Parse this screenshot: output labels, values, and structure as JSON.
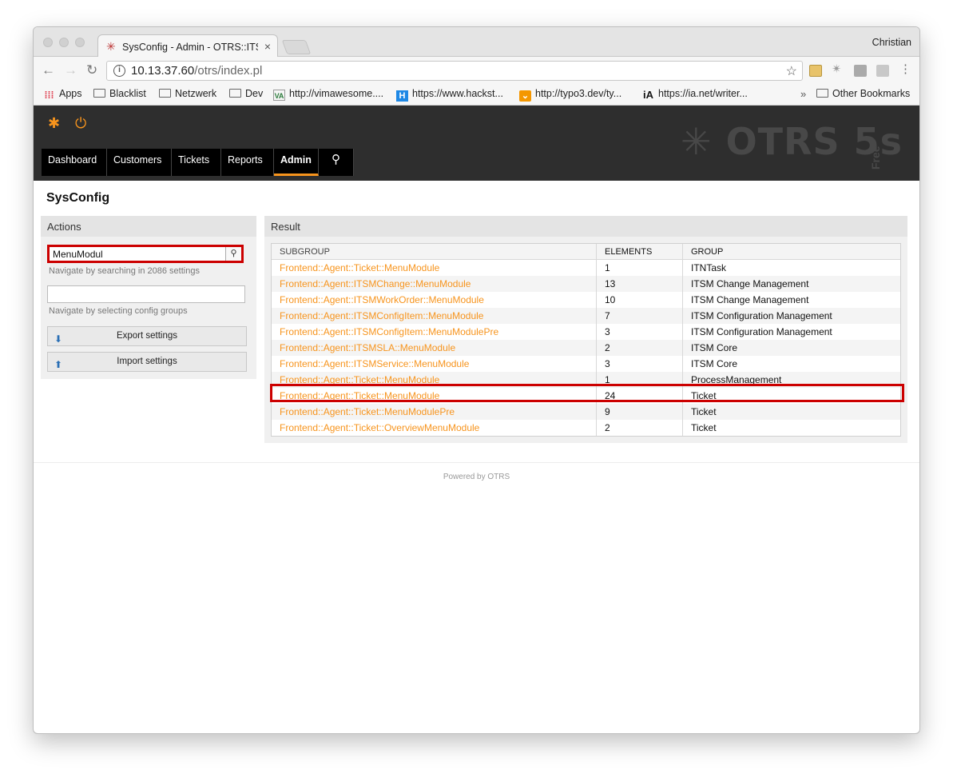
{
  "browser": {
    "tab_title": "SysConfig - Admin - OTRS::ITSM",
    "user_name": "Christian",
    "url_host": "10.13.37.60",
    "url_path": "/otrs/index.pl"
  },
  "bookmarks": {
    "apps": "Apps",
    "items": [
      "Blacklist",
      "Netzwerk",
      "Dev",
      "http://vimawesome....",
      "https://www.hackst...",
      "http://typo3.dev/ty...",
      "https://ia.net/writer..."
    ],
    "overflow": "»",
    "other": "Other Bookmarks"
  },
  "otrs": {
    "logo_text": "OTRS 5s",
    "logo_sub": "Free",
    "nav": [
      "Dashboard",
      "Customers",
      "Tickets",
      "Reports",
      "Admin"
    ],
    "active_nav": "Admin"
  },
  "page": {
    "title": "SysConfig"
  },
  "actions": {
    "header": "Actions",
    "search_value": "MenuModul",
    "search_hint": "Navigate by searching in 2086 settings",
    "group_hint": "Navigate by selecting config groups",
    "export_label": "Export settings",
    "import_label": "Import settings"
  },
  "result": {
    "header": "Result",
    "columns": [
      "SUBGROUP",
      "ELEMENTS",
      "GROUP"
    ],
    "rows": [
      {
        "subgroup": "Frontend::Agent::Ticket::MenuModule",
        "elements": "1",
        "group": "ITNTask"
      },
      {
        "subgroup": "Frontend::Agent::ITSMChange::MenuModule",
        "elements": "13",
        "group": "ITSM Change Management"
      },
      {
        "subgroup": "Frontend::Agent::ITSMWorkOrder::MenuModule",
        "elements": "10",
        "group": "ITSM Change Management"
      },
      {
        "subgroup": "Frontend::Agent::ITSMConfigItem::MenuModule",
        "elements": "7",
        "group": "ITSM Configuration Management"
      },
      {
        "subgroup": "Frontend::Agent::ITSMConfigItem::MenuModulePre",
        "elements": "3",
        "group": "ITSM Configuration Management"
      },
      {
        "subgroup": "Frontend::Agent::ITSMSLA::MenuModule",
        "elements": "2",
        "group": "ITSM Core"
      },
      {
        "subgroup": "Frontend::Agent::ITSMService::MenuModule",
        "elements": "3",
        "group": "ITSM Core"
      },
      {
        "subgroup": "Frontend::Agent::Ticket::MenuModule",
        "elements": "1",
        "group": "ProcessManagement"
      },
      {
        "subgroup": "Frontend::Agent::Ticket::MenuModule",
        "elements": "24",
        "group": "Ticket"
      },
      {
        "subgroup": "Frontend::Agent::Ticket::MenuModulePre",
        "elements": "9",
        "group": "Ticket"
      },
      {
        "subgroup": "Frontend::Agent::Ticket::OverviewMenuModule",
        "elements": "2",
        "group": "Ticket"
      }
    ]
  },
  "footer": {
    "text": "Powered by OTRS"
  },
  "colors": {
    "accent": "#f7941d",
    "highlight": "#cc0000",
    "header_bg": "#2e2e2e"
  }
}
